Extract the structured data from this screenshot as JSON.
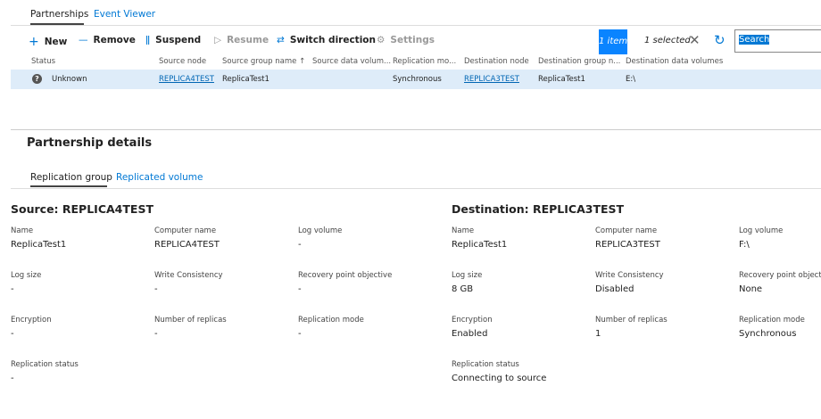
{
  "tabs": [
    {
      "label": "Partnerships",
      "active": true
    },
    {
      "label": "Event Viewer",
      "active": false
    }
  ],
  "toolbar": {
    "new": "New",
    "remove": "Remove",
    "suspend": "Suspend",
    "resume": "Resume",
    "switch": "Switch direction",
    "settings": "Settings",
    "item_count": "1 item",
    "selected": "1 selected",
    "search_value": "Search"
  },
  "table": {
    "columns": [
      "Status",
      "Source node",
      "Source group name",
      "Source data volum...",
      "Replication mo...",
      "Destination node",
      "Destination group n...",
      "Destination data volumes"
    ],
    "rows": [
      [
        "Unknown",
        "REPLICA4TEST",
        "ReplicaTest1",
        "",
        "Synchronous",
        "REPLICA3TEST",
        "ReplicaTest1",
        "E:\\"
      ]
    ]
  },
  "details": {
    "title": "Partnership details",
    "tabs": [
      {
        "label": "Replication group",
        "active": true
      },
      {
        "label": "Replicated volume",
        "active": false
      }
    ],
    "source": {
      "heading": "Source: REPLICA4TEST",
      "fields": [
        {
          "label": "Name",
          "value": "ReplicaTest1"
        },
        {
          "label": "Computer name",
          "value": "REPLICA4TEST"
        },
        {
          "label": "Log volume",
          "value": "-"
        },
        {
          "label": "Log size",
          "value": "-"
        },
        {
          "label": "Write Consistency",
          "value": "-"
        },
        {
          "label": "Recovery point objective",
          "value": "-"
        },
        {
          "label": "Encryption",
          "value": "-"
        },
        {
          "label": "Number of replicas",
          "value": "-"
        },
        {
          "label": "Replication mode",
          "value": "-"
        },
        {
          "label": "Replication status",
          "value": "-"
        }
      ]
    },
    "destination": {
      "heading": "Destination: REPLICA3TEST",
      "fields": [
        {
          "label": "Name",
          "value": "ReplicaTest1"
        },
        {
          "label": "Computer name",
          "value": "REPLICA3TEST"
        },
        {
          "label": "Log volume",
          "value": "F:\\"
        },
        {
          "label": "Log size",
          "value": "8 GB"
        },
        {
          "label": "Write Consistency",
          "value": "Disabled"
        },
        {
          "label": "Recovery point objective",
          "value": "None"
        },
        {
          "label": "Encryption",
          "value": "Enabled"
        },
        {
          "label": "Number of replicas",
          "value": "1"
        },
        {
          "label": "Replication mode",
          "value": "Synchronous"
        },
        {
          "label": "Replication status",
          "value": "Connecting to source"
        }
      ]
    }
  },
  "colors": {
    "accent": "#0078d4",
    "row_selected": "#deecf9"
  }
}
